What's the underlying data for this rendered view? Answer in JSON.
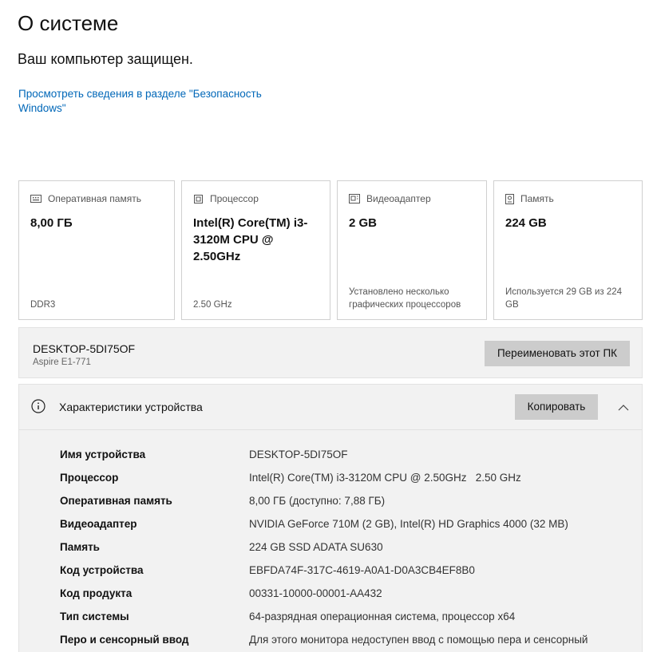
{
  "page": {
    "title": "О системе",
    "protected_text": "Ваш компьютер защищен.",
    "security_link": "Просмотреть сведения в разделе \"Безопасность Windows\""
  },
  "cards": [
    {
      "icon": "memory-icon",
      "label": "Оперативная память",
      "value": "8,00 ГБ",
      "footer": "DDR3"
    },
    {
      "icon": "processor-icon",
      "label": "Процессор",
      "value": "Intel(R) Core(TM) i3-3120M CPU @ 2.50GHz",
      "footer": "2.50 GHz"
    },
    {
      "icon": "display-adapter-icon",
      "label": "Видеоадаптер",
      "value": "2 GB",
      "footer": "Установлено несколько графических процессоров"
    },
    {
      "icon": "storage-icon",
      "label": "Память",
      "value": "224 GB",
      "footer": "Используется 29 GB из 224 GB"
    }
  ],
  "pc": {
    "name": "DESKTOP-5DI75OF",
    "model": "Aspire E1-771",
    "rename_button": "Переименовать этот ПК"
  },
  "specs": {
    "header": "Характеристики устройства",
    "copy_button": "Копировать",
    "rows": [
      {
        "key": "Имя устройства",
        "value": "DESKTOP-5DI75OF"
      },
      {
        "key": "Процессор",
        "value": "Intel(R) Core(TM) i3-3120M CPU @ 2.50GHz   2.50 GHz"
      },
      {
        "key": "Оперативная память",
        "value": "8,00 ГБ (доступно: 7,88 ГБ)"
      },
      {
        "key": "Видеоадаптер",
        "value": "NVIDIA GeForce 710M (2 GB), Intel(R) HD Graphics 4000 (32 MB)"
      },
      {
        "key": "Память",
        "value": "224 GB SSD ADATA SU630"
      },
      {
        "key": "Код устройства",
        "value": "EBFDA74F-317C-4619-A0A1-D0A3CB4EF8B0"
      },
      {
        "key": "Код продукта",
        "value": "00331-10000-00001-AA432"
      },
      {
        "key": "Тип системы",
        "value": "64-разрядная операционная система, процессор x64"
      },
      {
        "key": "Перо и сенсорный ввод",
        "value": "Для этого монитора недоступен ввод с помощью пера и сенсорный"
      }
    ]
  },
  "colors": {
    "link": "#0067b8",
    "button": "#cccccc",
    "panel": "#f2f2f2"
  }
}
